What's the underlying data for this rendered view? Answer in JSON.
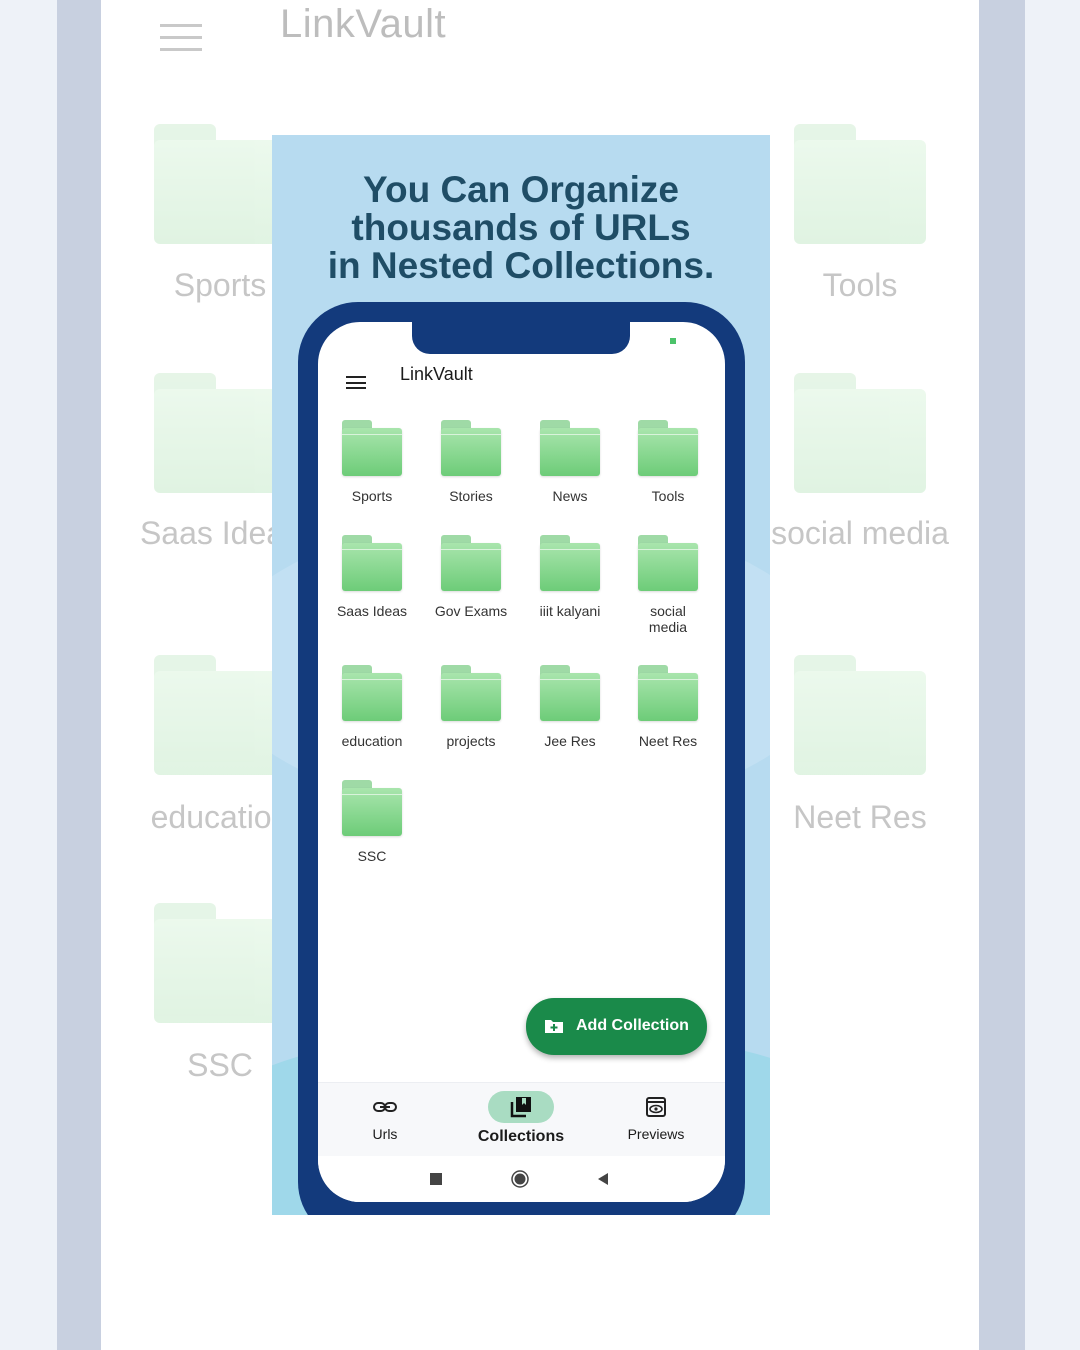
{
  "background": {
    "app_title": "LinkVault",
    "left_labels": [
      "Sports",
      "Saas Ideas",
      "education",
      "SSC"
    ],
    "right_labels": [
      "Tools",
      "social media",
      "Neet Res"
    ]
  },
  "panel": {
    "headline": [
      "You Can Organize",
      "thousands of URLs",
      "in Nested Collections."
    ]
  },
  "app": {
    "title": "LinkVault",
    "menu_icon": "hamburger-menu-icon",
    "collections": [
      {
        "label": "Sports"
      },
      {
        "label": "Stories"
      },
      {
        "label": "News"
      },
      {
        "label": "Tools"
      },
      {
        "label": "Saas Ideas"
      },
      {
        "label": "Gov Exams"
      },
      {
        "label": "iiit kalyani"
      },
      {
        "label": "social\nmedia"
      },
      {
        "label": "education"
      },
      {
        "label": "projects"
      },
      {
        "label": "Jee Res"
      },
      {
        "label": "Neet Res"
      },
      {
        "label": "SSC"
      }
    ],
    "fab": {
      "label": "Add Collection",
      "icon": "folder-add-icon"
    },
    "bottom_nav": [
      {
        "label": "Urls",
        "icon": "link-icon"
      },
      {
        "label": "Collections",
        "icon": "collections-icon",
        "active": true
      },
      {
        "label": "Previews",
        "icon": "preview-icon"
      }
    ],
    "system_nav": [
      "recents-icon",
      "home-icon",
      "back-icon"
    ]
  },
  "colors": {
    "panel_bg": "#b7dbf0",
    "phone_frame": "#133a7c",
    "fab": "#1a8a4a",
    "folder": "#6dcc78",
    "nav_active_pill": "#a9dcc2",
    "headline": "#1f4d66"
  }
}
